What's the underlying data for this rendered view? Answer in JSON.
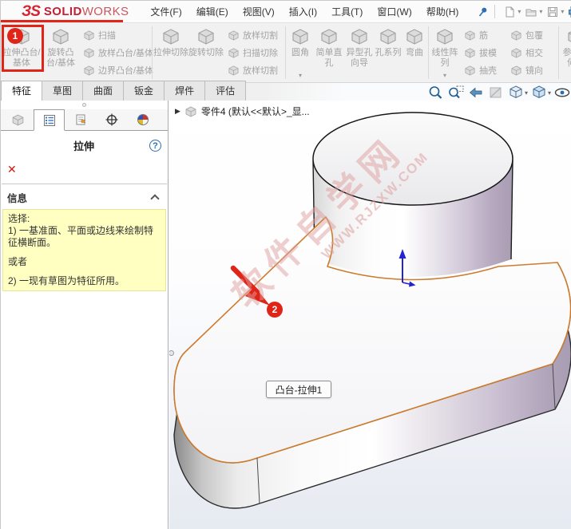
{
  "menubar": {
    "logo": {
      "glyph": "ЗS",
      "brand_bold": "SOLID",
      "brand_light": "WORKS"
    },
    "menus": [
      "文件(F)",
      "编辑(E)",
      "视图(V)",
      "插入(I)",
      "工具(T)",
      "窗口(W)",
      "帮助(H)"
    ]
  },
  "ribbon": {
    "buttons": {
      "extrude_boss": "拉伸凸台/基体",
      "revolve_boss": "旋转凸台/基体",
      "sweep": "扫描",
      "loft_boss": "放样凸台/基体",
      "boundary_boss": "边界凸台/基体",
      "extrude_cut": "拉伸切除",
      "revolve_cut": "旋转切除",
      "loft_cut_a": "放样切割",
      "sweep_cut": "扫描切除",
      "loft_cut_b": "放样切割",
      "fillet": "圆角",
      "simple_hole": "简单直孔",
      "hole_wizard": "异型孔向导",
      "hole_series": "孔系列",
      "flex": "弯曲",
      "linear_pattern": "线性阵列",
      "rib": "筋",
      "draft": "拔模",
      "shell": "抽壳",
      "wrap": "包覆",
      "intersect": "相交",
      "mirror": "镜向",
      "reference_geometry": "参考几何体"
    }
  },
  "tabs": [
    "特征",
    "草图",
    "曲面",
    "钣金",
    "焊件",
    "评估"
  ],
  "panel": {
    "title": "拉伸",
    "help_label": "?",
    "close_label": "✕",
    "info_header": "信息",
    "message_lines": [
      "选择:",
      "1) 一基准面、平面或边线来绘制特征横断面。",
      "",
      "或者",
      "",
      "2) 一现有草图为特征所用。"
    ]
  },
  "viewport": {
    "tree_label": "零件4 (默认<<默认>_显...",
    "tooltip": "凸台-拉伸1",
    "watermark_line1": "软件自学网",
    "watermark_line2": "WWW.RJZXW.COM"
  },
  "annotations": {
    "step1": "1",
    "step2": "2"
  },
  "colors": {
    "annotation_red": "#e02518",
    "edge_orange": "#cd7c2e",
    "message_yellow": "#ffffc2",
    "brand_red": "#c22033"
  }
}
